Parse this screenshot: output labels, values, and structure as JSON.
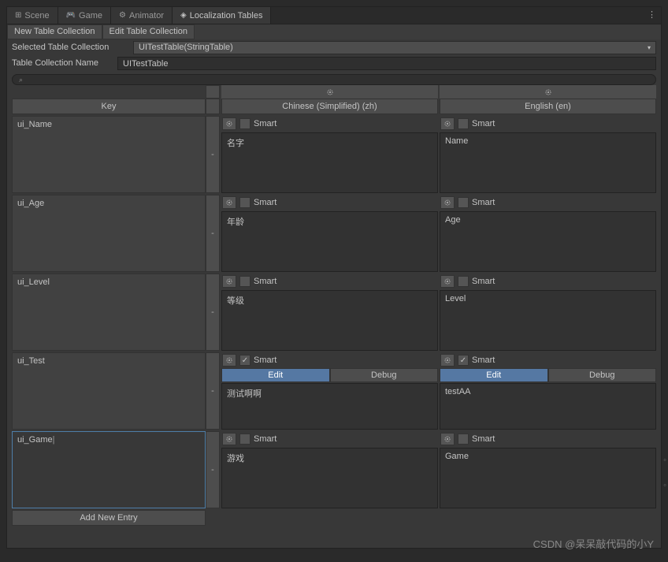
{
  "tabs": {
    "scene": "Scene",
    "game": "Game",
    "animator": "Animator",
    "localization": "Localization Tables"
  },
  "sub_tabs": {
    "new": "New Table Collection",
    "edit": "Edit Table Collection"
  },
  "collection": {
    "selected_label": "Selected Table Collection",
    "selected_value": "UITestTable(StringTable)",
    "name_label": "Table Collection Name",
    "name_value": "UITestTable"
  },
  "headers": {
    "key": "Key",
    "lang_zh": "Chinese (Simplified) (zh)",
    "lang_en": "English (en)"
  },
  "labels": {
    "smart": "Smart",
    "edit": "Edit",
    "debug": "Debug",
    "add_new": "Add New Entry"
  },
  "entries": [
    {
      "key": "ui_Name",
      "zh_smart": false,
      "en_smart": false,
      "zh": "名字",
      "en": "Name",
      "edit_mode": false
    },
    {
      "key": "ui_Age",
      "zh_smart": false,
      "en_smart": false,
      "zh": "年龄",
      "en": "Age",
      "edit_mode": false
    },
    {
      "key": "ui_Level",
      "zh_smart": false,
      "en_smart": false,
      "zh": "等级",
      "en": "Level",
      "edit_mode": false
    },
    {
      "key": "ui_Test",
      "zh_smart": true,
      "en_smart": true,
      "zh": "测试啊啊",
      "en": "testAA",
      "edit_mode": true
    },
    {
      "key": "ui_Game",
      "zh_smart": false,
      "en_smart": false,
      "zh": "游戏",
      "en": "Game",
      "edit_mode": false,
      "active": true
    }
  ],
  "watermark": "CSDN @呆呆敲代码的小Y"
}
